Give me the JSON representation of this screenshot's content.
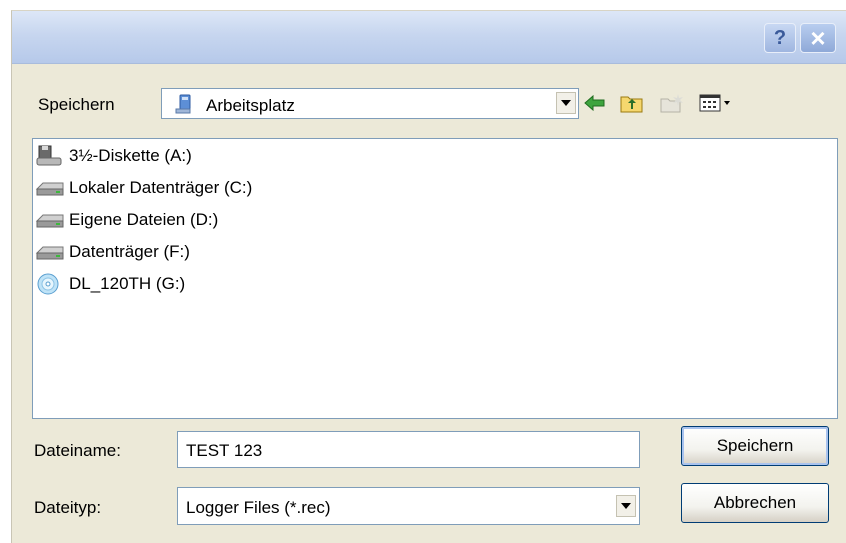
{
  "titlebar": {
    "help_label": "?",
    "close_label": "×"
  },
  "location": {
    "label": "Speichern",
    "current": "Arbeitsplatz",
    "icon": "computer-icon"
  },
  "toolbar": {
    "icons": [
      "back-arrow-icon",
      "up-folder-icon",
      "new-folder-icon",
      "view-menu-icon"
    ]
  },
  "files": [
    {
      "name": "3½-Diskette (A:)",
      "icon": "floppy-drive-icon"
    },
    {
      "name": "Lokaler Datenträger (C:)",
      "icon": "hard-drive-icon"
    },
    {
      "name": "Eigene Dateien (D:)",
      "icon": "hard-drive-icon"
    },
    {
      "name": "Datenträger (F:)",
      "icon": "hard-drive-icon"
    },
    {
      "name": "DL_120TH (G:)",
      "icon": "cd-drive-icon"
    }
  ],
  "filename": {
    "label": "Dateiname:",
    "value": "TEST 123"
  },
  "filetype": {
    "label": "Dateityp:",
    "value": "Logger Files (*.rec)"
  },
  "buttons": {
    "save": "Speichern",
    "cancel": "Abbrechen"
  },
  "colors": {
    "dialog_bg": "#ece9d8",
    "titlebar": "#c7d6ef",
    "input_border": "#7f9db9",
    "button_border": "#003c74"
  }
}
